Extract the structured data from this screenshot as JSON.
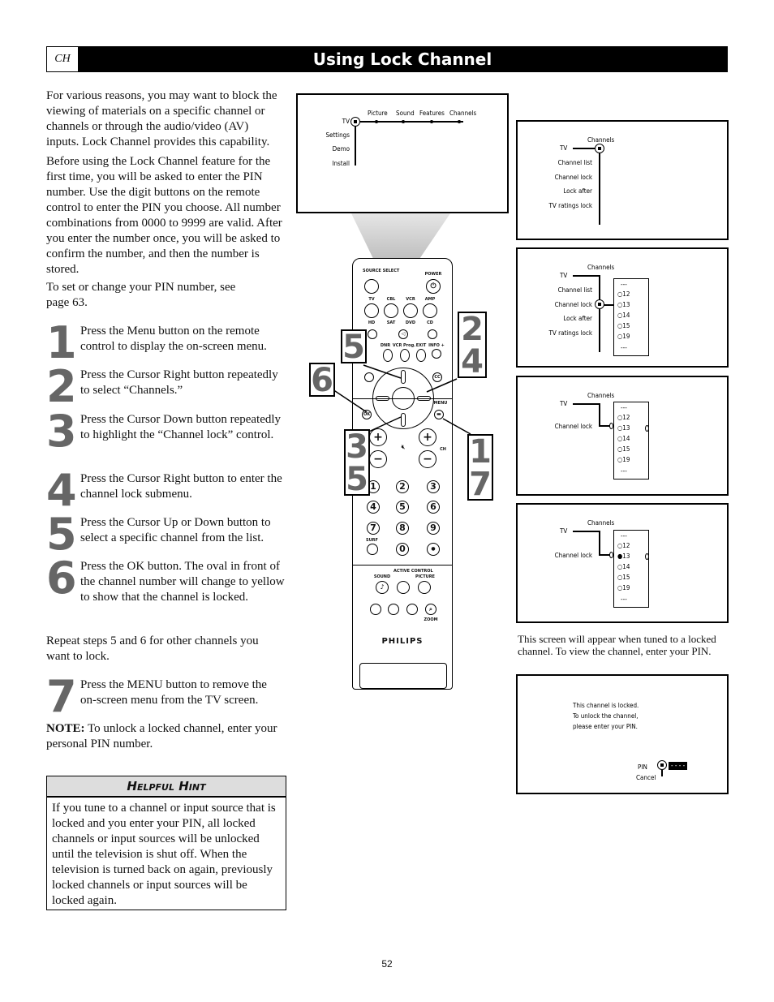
{
  "header": {
    "section_tag": "CH",
    "title": "Using Lock Channel"
  },
  "intro": [
    "For various reasons, you may want to block the viewing of materials on a specific channel or channels or through the audio/video (AV) inputs. Lock Channel provides this capability.",
    "Before using the Lock Channel feature for the first time, you will be asked to enter the PIN number. Use the digit buttons on the remote control to enter the PIN you choose. All number combinations from 0000 to 9999 are valid. After you enter the number once, you will be asked to confirm the number, and then the number is stored.",
    "To set or change your PIN number, see page 63."
  ],
  "steps": [
    {
      "num": "1",
      "text": "Press the Menu button on the remote control to display the on-screen menu."
    },
    {
      "num": "2",
      "text": "Press the Cursor Right button repeatedly to select “Channels.”"
    },
    {
      "num": "3",
      "text": "Press the Cursor Down button repeatedly to highlight the “Channel lock” control."
    },
    {
      "num": "4",
      "text": "Press the Cursor Right button to enter the channel lock submenu."
    },
    {
      "num": "5",
      "text": "Press the Cursor Up or Down button to select a specific channel from the list."
    },
    {
      "num": "6",
      "text": "Press the OK button. The oval in front of the channel number will change to yellow to show that the channel is locked."
    },
    {
      "num": "7",
      "text": "Press the MENU button to remove the on-screen menu from the TV screen."
    }
  ],
  "repeat_note": "Repeat steps 5 and 6 for other channels you want to lock.",
  "note": {
    "label": "NOTE:",
    "text": " To unlock a locked channel, enter your personal PIN number."
  },
  "hint": {
    "title": "Helpful Hint",
    "text": "If you tune to a channel or input source that is locked and you enter your PIN, all locked channels or input sources will be unlocked until the television is shut off. When the television is turned back on again, previously locked channels or input sources will be locked again."
  },
  "screen_main": {
    "root": "TV",
    "top_items": [
      "Picture",
      "Sound",
      "Features",
      "Channels"
    ],
    "side_items": [
      "Settings",
      "Demo",
      "Install"
    ]
  },
  "screen_channels": {
    "root": "TV",
    "header": "Channels",
    "items": [
      "Channel list",
      "Channel lock",
      "Lock after",
      "TV ratings lock"
    ]
  },
  "channel_list": {
    "ellipsis": "---",
    "channels": [
      "12",
      "13",
      "14",
      "15",
      "19"
    ]
  },
  "screen_lock": {
    "root": "TV",
    "header": "Channels",
    "item": "Channel lock"
  },
  "locked_caption": "This screen will appear when tuned to a locked channel. To view the channel, enter your PIN.",
  "locked_screen": {
    "message": [
      "This channel is locked.",
      "To unlock the channel,",
      "please enter your PIN."
    ],
    "pin_label": "PIN",
    "pin_value": "- - - -",
    "cancel_label": "Cancel"
  },
  "remote": {
    "brand": "PHILIPS",
    "labels": {
      "source": "SOURCE SELECT",
      "power": "POWER",
      "tv": "TV",
      "cbl": "CBL",
      "vcr": "VCR",
      "amp": "AMP",
      "hd": "HD",
      "sat": "SAT",
      "dvd": "DVD",
      "cd": "CD",
      "dnr": "DNR",
      "vcrprog": "VCR Prog.",
      "exit": "EXIT",
      "info": "INFO +",
      "cc": "CC",
      "ok": "OK",
      "menu": "MENU",
      "ch": "CH",
      "surf": "SURF",
      "sound": "SOUND",
      "active": "ACTIVE CONTROL",
      "picture": "PICTURE",
      "zoom": "ZOOM"
    },
    "digits": [
      "1",
      "2",
      "3",
      "4",
      "5",
      "6",
      "7",
      "8",
      "9",
      "0"
    ],
    "callouts": {
      "up": "5",
      "right": "2 4",
      "ok": "6",
      "down": "3 5",
      "menu": "1 7"
    }
  },
  "page_number": "52"
}
